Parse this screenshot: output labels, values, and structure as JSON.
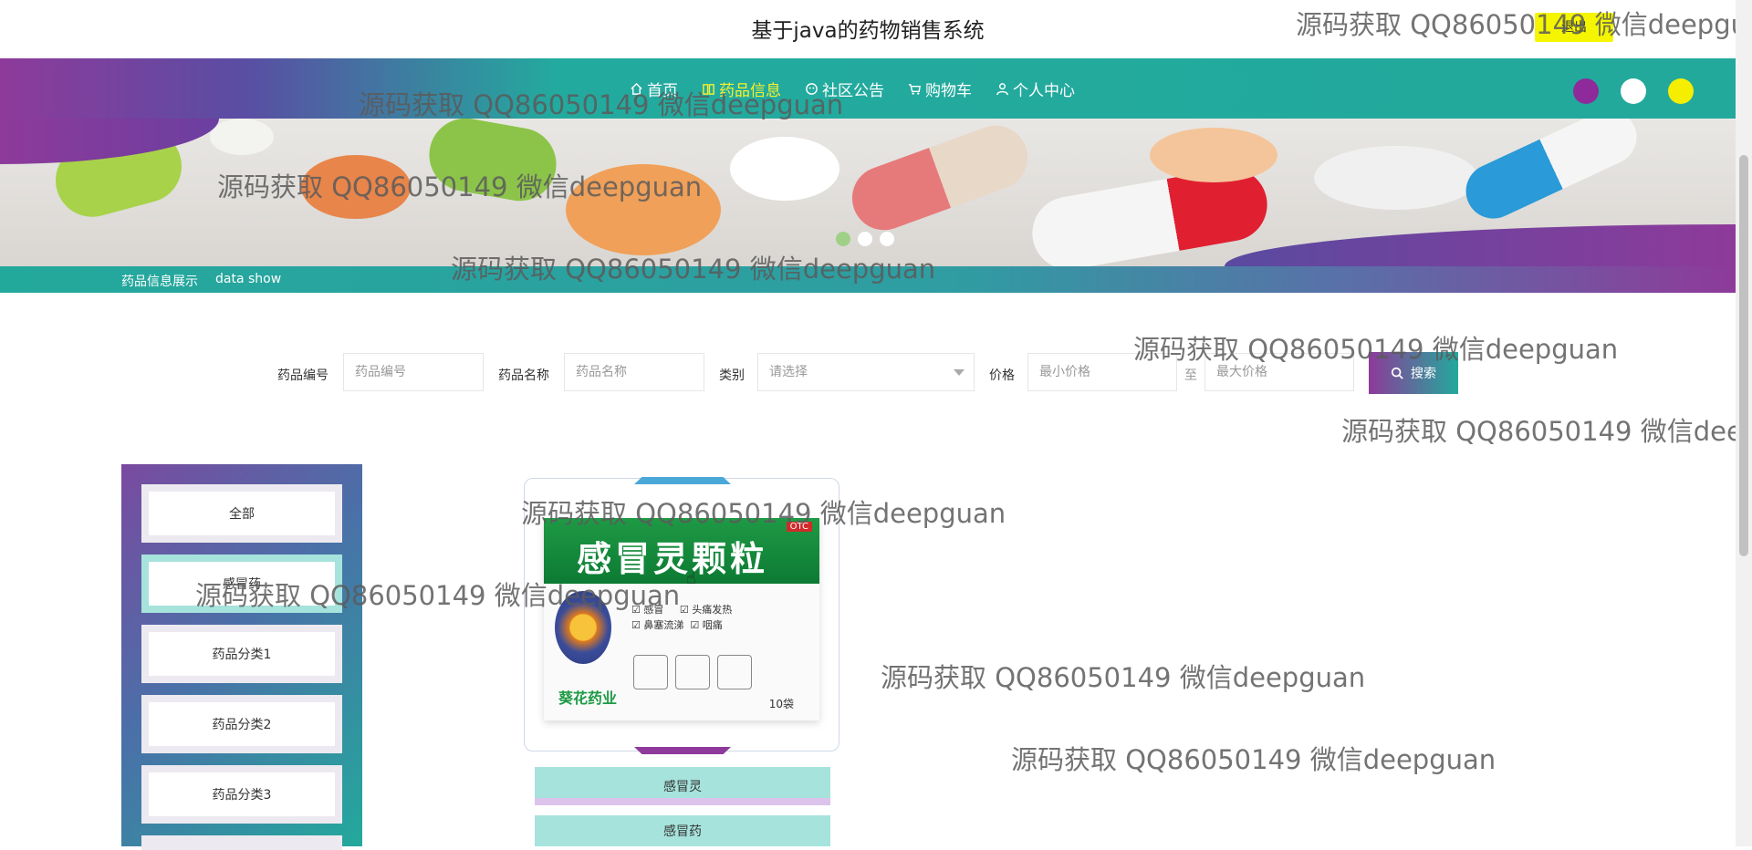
{
  "header": {
    "title": "基于java的药物销售系统",
    "logout_label": "退出"
  },
  "nav": {
    "items": [
      {
        "label": "首页",
        "icon": "home-icon",
        "active": false
      },
      {
        "label": "药品信息",
        "icon": "book-icon",
        "active": true
      },
      {
        "label": "社区公告",
        "icon": "chat-icon",
        "active": false
      },
      {
        "label": "购物车",
        "icon": "cart-icon",
        "active": false
      },
      {
        "label": "个人中心",
        "icon": "user-icon",
        "active": false
      }
    ],
    "theme_colors": [
      "#8e2a9a",
      "#ffffff",
      "#f5ee00"
    ]
  },
  "banner": {
    "dots": 3,
    "active_dot": 0
  },
  "section": {
    "title_cn": "药品信息展示",
    "title_en": "data show"
  },
  "search": {
    "code_label": "药品编号",
    "code_placeholder": "药品编号",
    "name_label": "药品名称",
    "name_placeholder": "药品名称",
    "category_label": "类别",
    "category_value": "请选择",
    "price_label": "价格",
    "min_placeholder": "最小价格",
    "to_label": "至",
    "max_placeholder": "最大价格",
    "button_label": "搜索"
  },
  "categories": [
    {
      "label": "全部",
      "active": false
    },
    {
      "label": "感冒药",
      "active": true
    },
    {
      "label": "药品分类1",
      "active": false
    },
    {
      "label": "药品分类2",
      "active": false
    },
    {
      "label": "药品分类3",
      "active": false
    }
  ],
  "product": {
    "box_title": "感冒灵颗粒",
    "otc": "OTC",
    "brand": "葵花药业",
    "pack": "10袋",
    "checks": [
      "感冒",
      "头痛发热",
      "鼻塞流涕",
      "咽痛"
    ],
    "name": "感冒灵",
    "category": "感冒药"
  },
  "watermark": "源码获取 QQ86050149 微信deepguan"
}
